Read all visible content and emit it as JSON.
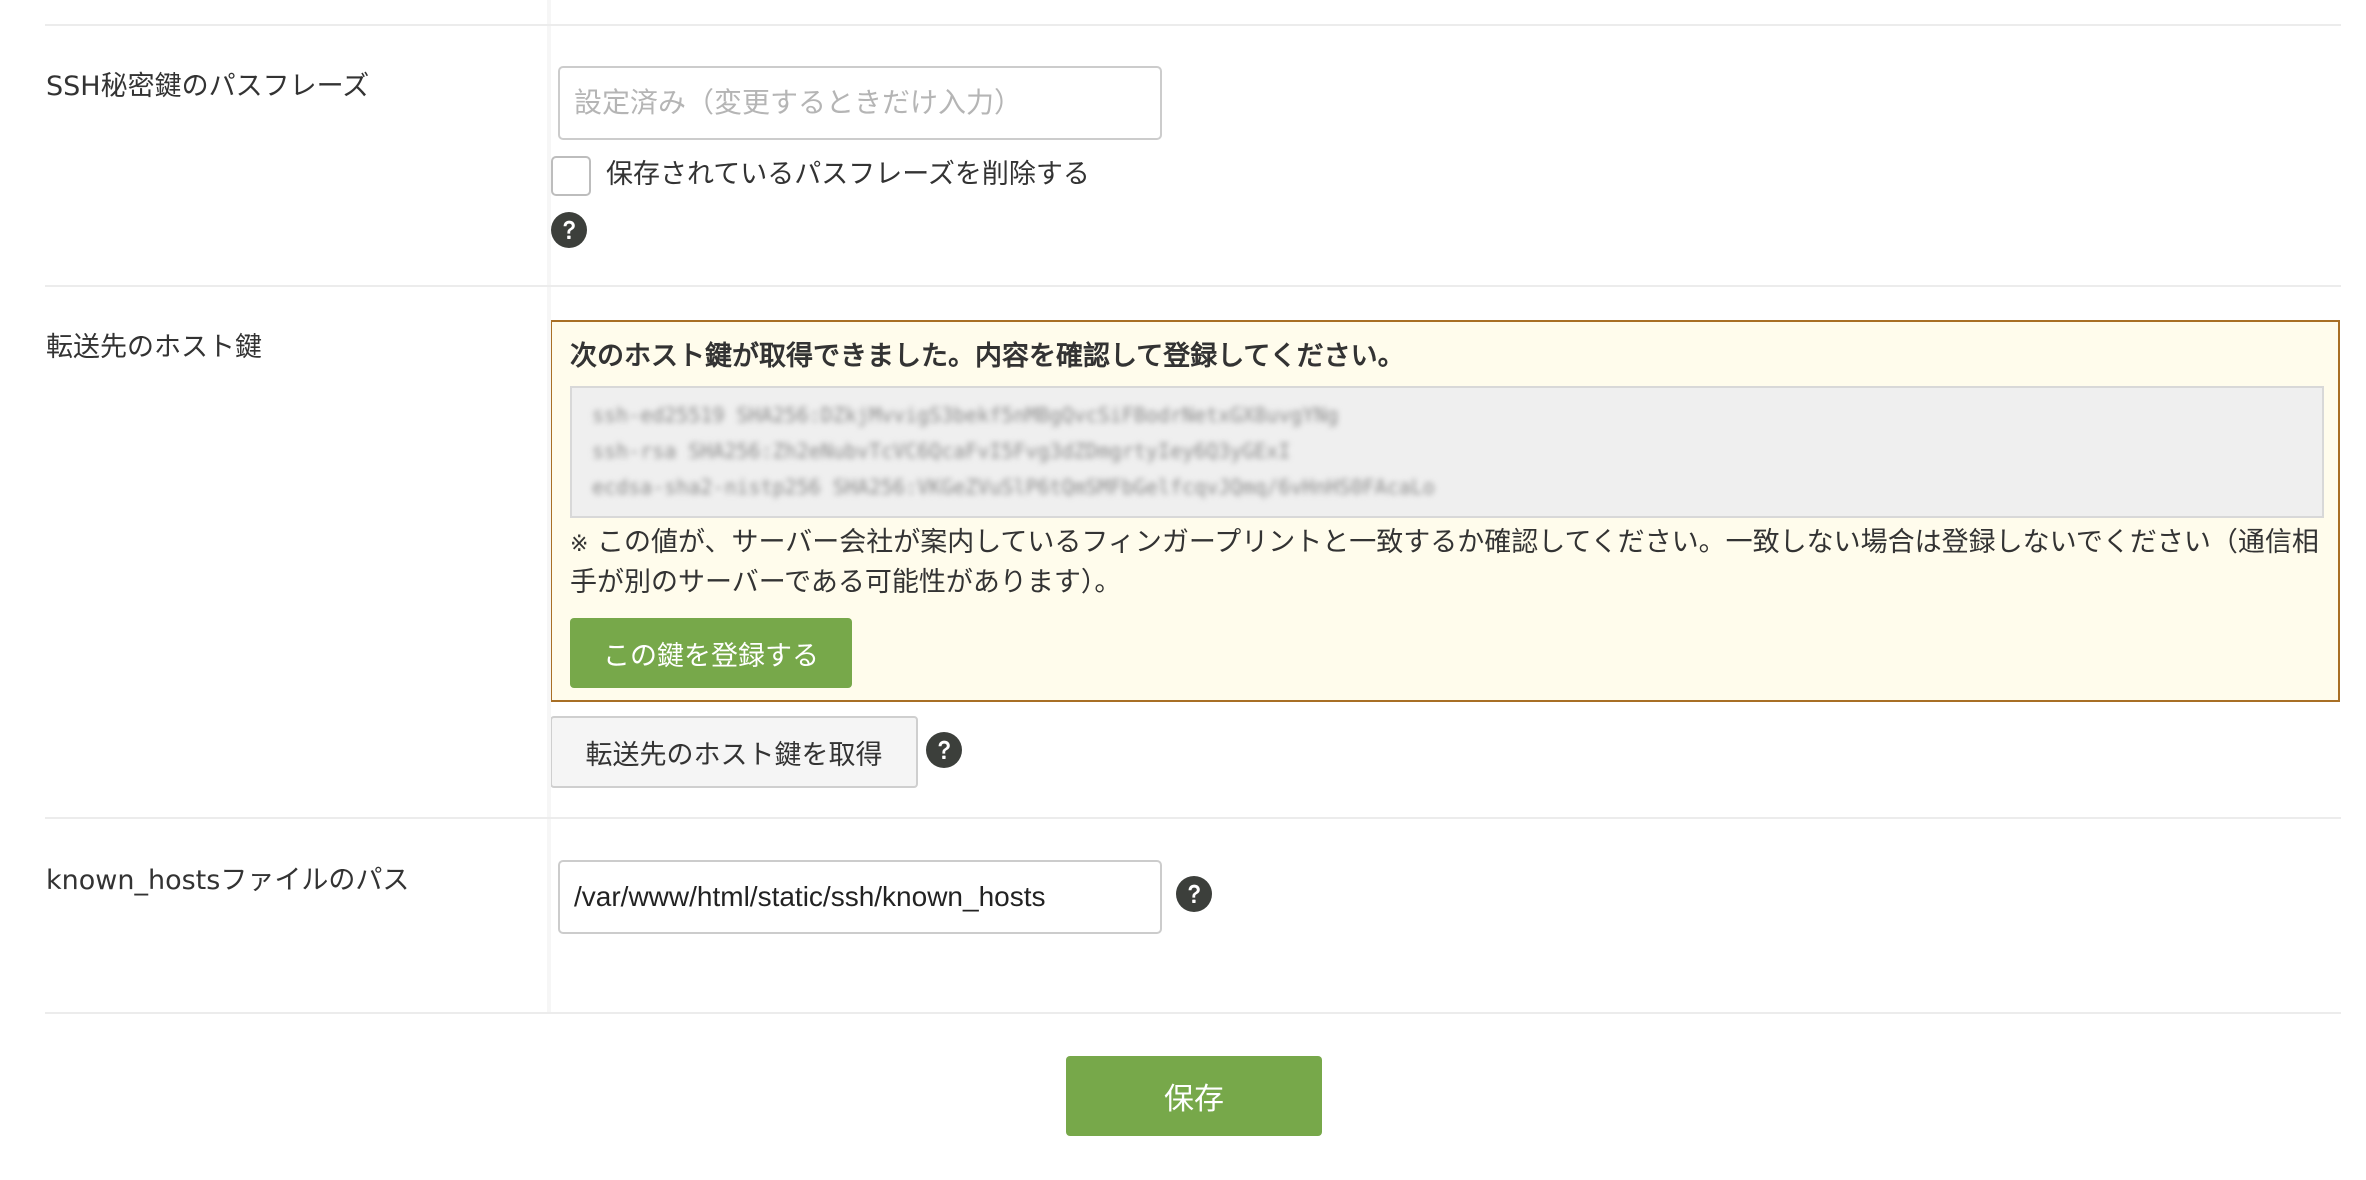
{
  "passphrase_row": {
    "label": "SSH秘密鍵のパスフレーズ",
    "input_placeholder": "設定済み（変更するときだけ入力）",
    "input_value": "",
    "delete_checkbox_label": "保存されているパスフレーズを削除する",
    "delete_checked": false
  },
  "host_key_row": {
    "label": "転送先のホスト鍵",
    "notice_title": "次のホスト鍵が取得できました。内容を確認して登録してください。",
    "key_lines": [
      "ssh-ed25519 SHA256:DZkjMvvigS3bekf5nMBgQvcSiFBodrNetxGX8uvgYNg",
      "ssh-rsa SHA256:Zh2eNubvTcVC6QcaFvI5Fvg3dZDmgrtyIey6Q3yGExI",
      "ecdsa-sha2-nistp256 SHA256:VKGeZVuSlP6tQmSMFbGelfcqvJQmq/6vHnHS0FAcaLo"
    ],
    "note_mark": "※",
    "note_text": "この値が、サーバー会社が案内しているフィンガープリントと一致するか確認してください。一致しない場合は登録しないでください（通信相手が別のサーバーである可能性があります）。",
    "register_button_label": "この鍵を登録する",
    "fetch_button_label": "転送先のホスト鍵を取得"
  },
  "known_hosts_row": {
    "label": "known_hostsファイルのパス",
    "input_value": "/var/www/html/static/ssh/known_hosts"
  },
  "save_button_label": "保存",
  "colors": {
    "primary_green": "#77a84a",
    "notice_border": "#a86f25",
    "notice_background": "#fffcec",
    "help_icon": "#3c3f3b"
  }
}
